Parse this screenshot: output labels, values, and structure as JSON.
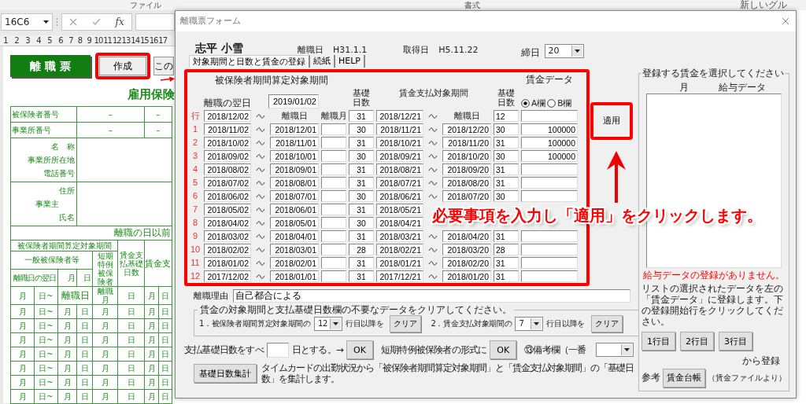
{
  "ribbon": {
    "labels": [
      "ファイル",
      "書式",
      "新しいグル"
    ]
  },
  "formula_bar": {
    "name_box": "16C6",
    "function_label": "fx"
  },
  "column_headers": [
    "1",
    "2",
    "3",
    "4",
    "5",
    "6",
    "7",
    "8",
    "9",
    "10",
    "11",
    "12",
    "13",
    "14",
    "15",
    "16",
    "17"
  ],
  "sheet": {
    "title_button": "離 職 票",
    "create_button": "作成",
    "next_button": "この",
    "form_title": "雇用保険",
    "id_rows": [
      {
        "label": "被保険者番号",
        "values": [
          "–",
          "–"
        ]
      },
      {
        "label": "事業所番号",
        "values": [
          "–",
          "–"
        ]
      }
    ],
    "office_labels": [
      "名　称",
      "事業所所在地",
      "電話番号"
    ],
    "owner_labels": [
      "住所",
      "事業主",
      "氏名"
    ],
    "section_title": "離職の日以前",
    "headers": {
      "period": "被保険者期間算定対象期間",
      "general": "一般被保険者等",
      "short_term": "短期特例被保険者",
      "base_days": "賃金支払基礎日数",
      "wage_period": "賃金支",
      "next_day": "離職日の翌日",
      "month": "月",
      "day": "日"
    },
    "first_row": [
      "月",
      "日~",
      "離職日",
      "離職月",
      "日",
      "月",
      "日"
    ],
    "rows": [
      [
        "月",
        "日~",
        "月",
        "日",
        "月",
        "日",
        "月",
        "日"
      ],
      [
        "月",
        "日~",
        "月",
        "日",
        "月",
        "日",
        "月",
        "日"
      ],
      [
        "月",
        "日~",
        "月",
        "日",
        "月",
        "日",
        "月",
        "日"
      ],
      [
        "月",
        "日~",
        "月",
        "日",
        "月",
        "日",
        "月",
        "日"
      ],
      [
        "月",
        "日~",
        "月",
        "日",
        "月",
        "日",
        "月",
        "日"
      ],
      [
        "月",
        "日~",
        "月",
        "日",
        "月",
        "日",
        "月",
        "日"
      ],
      [
        "月",
        "日~",
        "月",
        "日",
        "月",
        "日",
        "月",
        "日"
      ]
    ]
  },
  "dialog": {
    "title": "離職票フォーム",
    "employee_name": "志平 小雪",
    "leave_date_label": "離職日",
    "leave_date": "H31.1.1",
    "acquired_label": "取得日",
    "acquired_date": "H5.11.22",
    "cutoff_label": "締日",
    "cutoff": "20",
    "tabs": [
      {
        "label": "対象期間と日数と賃金の登録",
        "selected": true
      },
      {
        "label": "続紙",
        "selected": false
      },
      {
        "label": "HELP",
        "selected": false
      }
    ],
    "period_heading": "被保険者期間算定対象期間",
    "wage_heading": "賃金データ",
    "next_day_label": "離職の翌日",
    "next_day": "2019/01/02",
    "base_days_label": "基礎日数",
    "pay_period_heading": "賃金支払対象期間",
    "pay_base_days_label": "基礎日数",
    "wage_columns": [
      {
        "label": "A欄",
        "selected": true
      },
      {
        "label": "B欄",
        "selected": false
      }
    ],
    "rows": [
      {
        "label": "行",
        "start": "2018/12/02",
        "end_label": "離職日",
        "month_label": "離職月",
        "days": "31",
        "pay_start": "2018/12/21",
        "pay_end_label": "離職日",
        "pay_days": "12"
      },
      {
        "label": "1",
        "start": "2018/11/02",
        "end": "2018/12/01",
        "days": "30",
        "pay_start": "2018/11/21",
        "pay_end": "2018/12/20",
        "pay_days": "30",
        "wage": "100000"
      },
      {
        "label": "2",
        "start": "2018/10/02",
        "end": "2018/11/01",
        "days": "31",
        "pay_start": "2018/10/21",
        "pay_end": "2018/11/20",
        "pay_days": "31",
        "wage": "100000"
      },
      {
        "label": "3",
        "start": "2018/09/02",
        "end": "2018/10/01",
        "days": "30",
        "pay_start": "2018/09/21",
        "pay_end": "2018/10/20",
        "pay_days": "30",
        "wage": "100000"
      },
      {
        "label": "4",
        "start": "2018/08/02",
        "end": "2018/09/01",
        "days": "31",
        "pay_start": "2018/08/21",
        "pay_end": "2018/09/20",
        "pay_days": "31"
      },
      {
        "label": "5",
        "start": "2018/07/02",
        "end": "2018/08/01",
        "days": "31",
        "pay_start": "2018/07/21",
        "pay_end": "2018/08/20",
        "pay_days": "31"
      },
      {
        "label": "6",
        "start": "2018/06/02",
        "end": "2018/07/01",
        "days": "30",
        "pay_start": "2018/06/21",
        "pay_end": "2018/07/20",
        "pay_days": "30"
      },
      {
        "label": "7",
        "start": "2018/05/02",
        "end": "2018/06/01",
        "days": "31",
        "pay_start": "2018/05/21",
        "hidden_by_callout": true
      },
      {
        "label": "8",
        "start": "2018/04/02",
        "end": "2018/05/01",
        "days": "30",
        "pay_start": "2018/04/21",
        "hidden_by_callout": true
      },
      {
        "label": "9",
        "start": "2018/03/02",
        "end": "2018/04/01",
        "days": "31",
        "pay_start": "2018/03/21",
        "pay_end": "2018/04/20",
        "pay_days": "31"
      },
      {
        "label": "10",
        "start": "2018/02/02",
        "end": "2018/03/01",
        "days": "28",
        "pay_start": "2018/02/21",
        "pay_end": "2018/03/20",
        "pay_days": "28"
      },
      {
        "label": "11",
        "start": "2018/01/02",
        "end": "2018/02/01",
        "days": "31",
        "pay_start": "2018/01/21",
        "pay_end": "2018/02/20",
        "pay_days": "31"
      },
      {
        "label": "12",
        "start": "2017/12/02",
        "end": "2018/01/01",
        "days": "31",
        "pay_start": "2017/12/21",
        "pay_end": "2018/01/20",
        "pay_days": "31"
      }
    ],
    "apply_button": "適用",
    "callout": "必要事項を入力し「適用」をクリックします。",
    "reason_label": "離職理由",
    "reason": "自己都合による",
    "clear_group": {
      "legend": "賃金の対象期間と支払基礎日数欄の不要なデータをクリアしてください。",
      "items": [
        {
          "label": "1．被保険者期間算定対象期間の",
          "value": "12",
          "suffix": "行目以降を",
          "button": "クリア"
        },
        {
          "label": "2．賃金支払対象期間の",
          "value": "7",
          "suffix": "行目以降を",
          "button": "クリア"
        }
      ]
    },
    "fill_days": {
      "label": "支払基礎日数をすべ",
      "suffix": "日とする。→",
      "button": "OK"
    },
    "short_term": {
      "label": "短期特例被保険者の形式に",
      "button": "OK"
    },
    "remarks_label": "⑬備考欄（一番",
    "tally_button": "基礎日数集計",
    "tally_note": "タイムカードの出勤状況から「被保険者期間算定対象期間」と「賃金支払対象期間」の「基礎日数」を集計します。",
    "wage_select": {
      "legend": "登録する賃金を選択してください",
      "columns": [
        "月",
        "給与データ"
      ],
      "empty_message": "給与データの登録がありません。",
      "instructions": "リストの選択されたデータを左の「賃金データ」に登録します。下の登録開始行をクリックしてください。",
      "row_buttons": [
        "1行目",
        "2行目",
        "3行目"
      ],
      "register_label": "から登録",
      "reference_label": "参考",
      "ledger_button": "賃金台帳",
      "ledger_note": "（賃金ファイルより）"
    }
  }
}
